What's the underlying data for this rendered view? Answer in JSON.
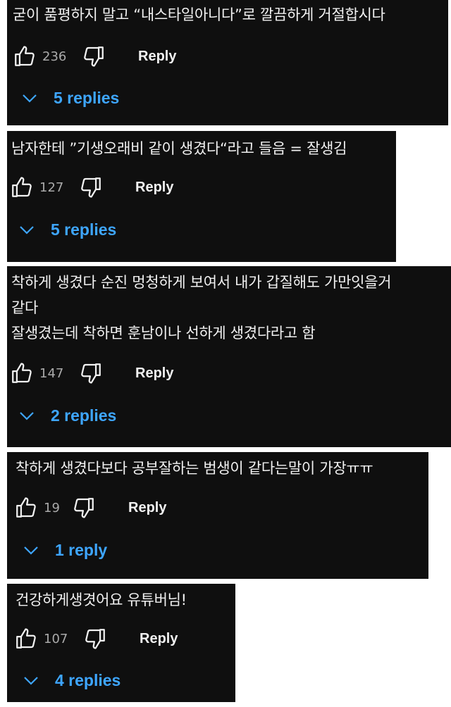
{
  "comments": [
    {
      "text": "굳이 품평하지 말고 “내스타일아니다”로 깔끔하게 거절합시다",
      "likes": "236",
      "reply_label": "Reply",
      "replies": "5 replies"
    },
    {
      "text": "남자한테 ”기생오래비 같이 생겼다“라고 들음 = 잘생김",
      "likes": "127",
      "reply_label": "Reply",
      "replies": "5 replies"
    },
    {
      "text_line1": "착하게 생겼다 순진 멍청하게 보여서 내가 갑질해도 가만잇을거",
      "text_line2": "같다",
      "text_line3": "잘생겼는데 착하면 훈남이나 선하게 생겼다라고 함",
      "likes": "147",
      "reply_label": "Reply",
      "replies": "2 replies"
    },
    {
      "text": "착하게 생겼다보다 공부잘하는 범생이 같다는말이 가장ㅠㅠ",
      "likes": "19",
      "reply_label": "Reply",
      "replies": "1 reply"
    },
    {
      "text": "건강하게생겻어요 유튜버님!",
      "likes": "107",
      "reply_label": "Reply",
      "replies": "4 replies"
    }
  ],
  "icons": {
    "like": "thumbs-up-icon",
    "dislike": "thumbs-down-icon",
    "expand": "chevron-down-icon"
  },
  "colors": {
    "card_bg": "#0f0f0f",
    "text": "#f1f1f1",
    "count": "#aaaaaa",
    "link": "#3ea6ff"
  }
}
